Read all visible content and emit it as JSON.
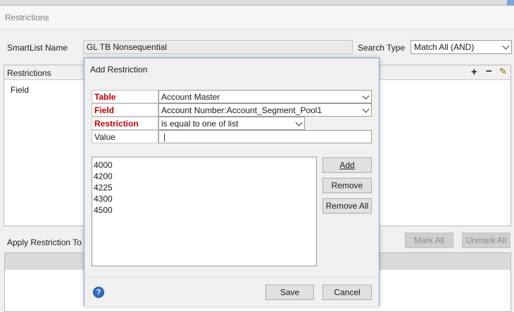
{
  "window": {
    "title": "Restrictions"
  },
  "form": {
    "smartlist_label": "SmartList Name",
    "smartlist_value": "GL TB Nonsequential",
    "search_type_label": "Search Type",
    "search_type_value": "Match All (AND)"
  },
  "restrictions_panel": {
    "title": "Restrictions",
    "column_field": "Field",
    "toolbar": {
      "add": "+",
      "remove": "−",
      "edit": "✎"
    }
  },
  "apply_panel": {
    "title": "Apply Restriction To",
    "mark_all": "Mark All",
    "unmark_all": "Unmark All"
  },
  "dialog": {
    "title": "Add Restriction",
    "rows": [
      {
        "label": "Table",
        "value": "Account Master",
        "required": true,
        "type": "combo"
      },
      {
        "label": "Field",
        "value": "Account Number:Account_Segment_Pool1",
        "required": true,
        "type": "combo"
      },
      {
        "label": "Restriction",
        "value": "is equal to one of list",
        "required": true,
        "type": "combo"
      },
      {
        "label": "Value",
        "value": "|",
        "required": false,
        "type": "text"
      }
    ],
    "list_values": [
      "4000",
      "4200",
      "4225",
      "4300",
      "4500"
    ],
    "add_button": "Add",
    "remove_button": "Remove",
    "remove_all_button": "Remove All",
    "help_icon": "?",
    "save_button": "Save",
    "cancel_button": "Cancel"
  }
}
